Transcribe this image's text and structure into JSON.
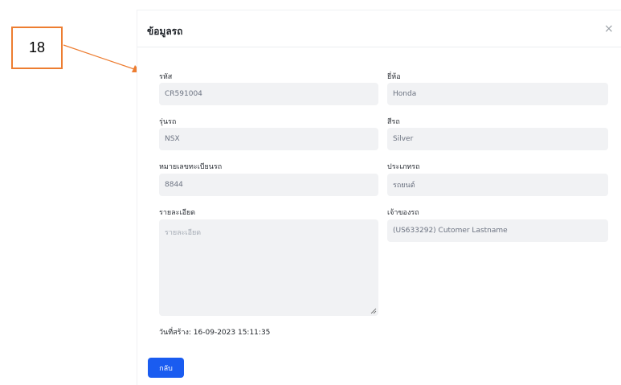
{
  "callout": {
    "number": "18"
  },
  "modal": {
    "title": "ข้อมูลรถ",
    "close_glyph": "×",
    "fields": {
      "code": {
        "label": "รหัส",
        "value": "CR591004"
      },
      "brand": {
        "label": "ยี่ห้อ",
        "value": "Honda"
      },
      "model": {
        "label": "รุ่นรถ",
        "value": "NSX"
      },
      "color": {
        "label": "สีรถ",
        "value": "Silver"
      },
      "plate": {
        "label": "หมายเลขทะเบียนรถ",
        "value": "8844"
      },
      "type": {
        "label": "ประเภทรถ",
        "value": "รถยนต์"
      },
      "detail": {
        "label": "รายละเอียด",
        "placeholder": "รายละเอียด",
        "value": ""
      },
      "owner": {
        "label": "เจ้าของรถ",
        "value": "(US633292) Cutomer Lastname"
      }
    },
    "created_at": "วันที่สร้าง: 16-09-2023 15:11:35",
    "back_button": "กลับ"
  },
  "colors": {
    "accent": "#1a5cf0",
    "callout_orange": "#ed7d31",
    "input_bg": "#f1f2f4"
  }
}
